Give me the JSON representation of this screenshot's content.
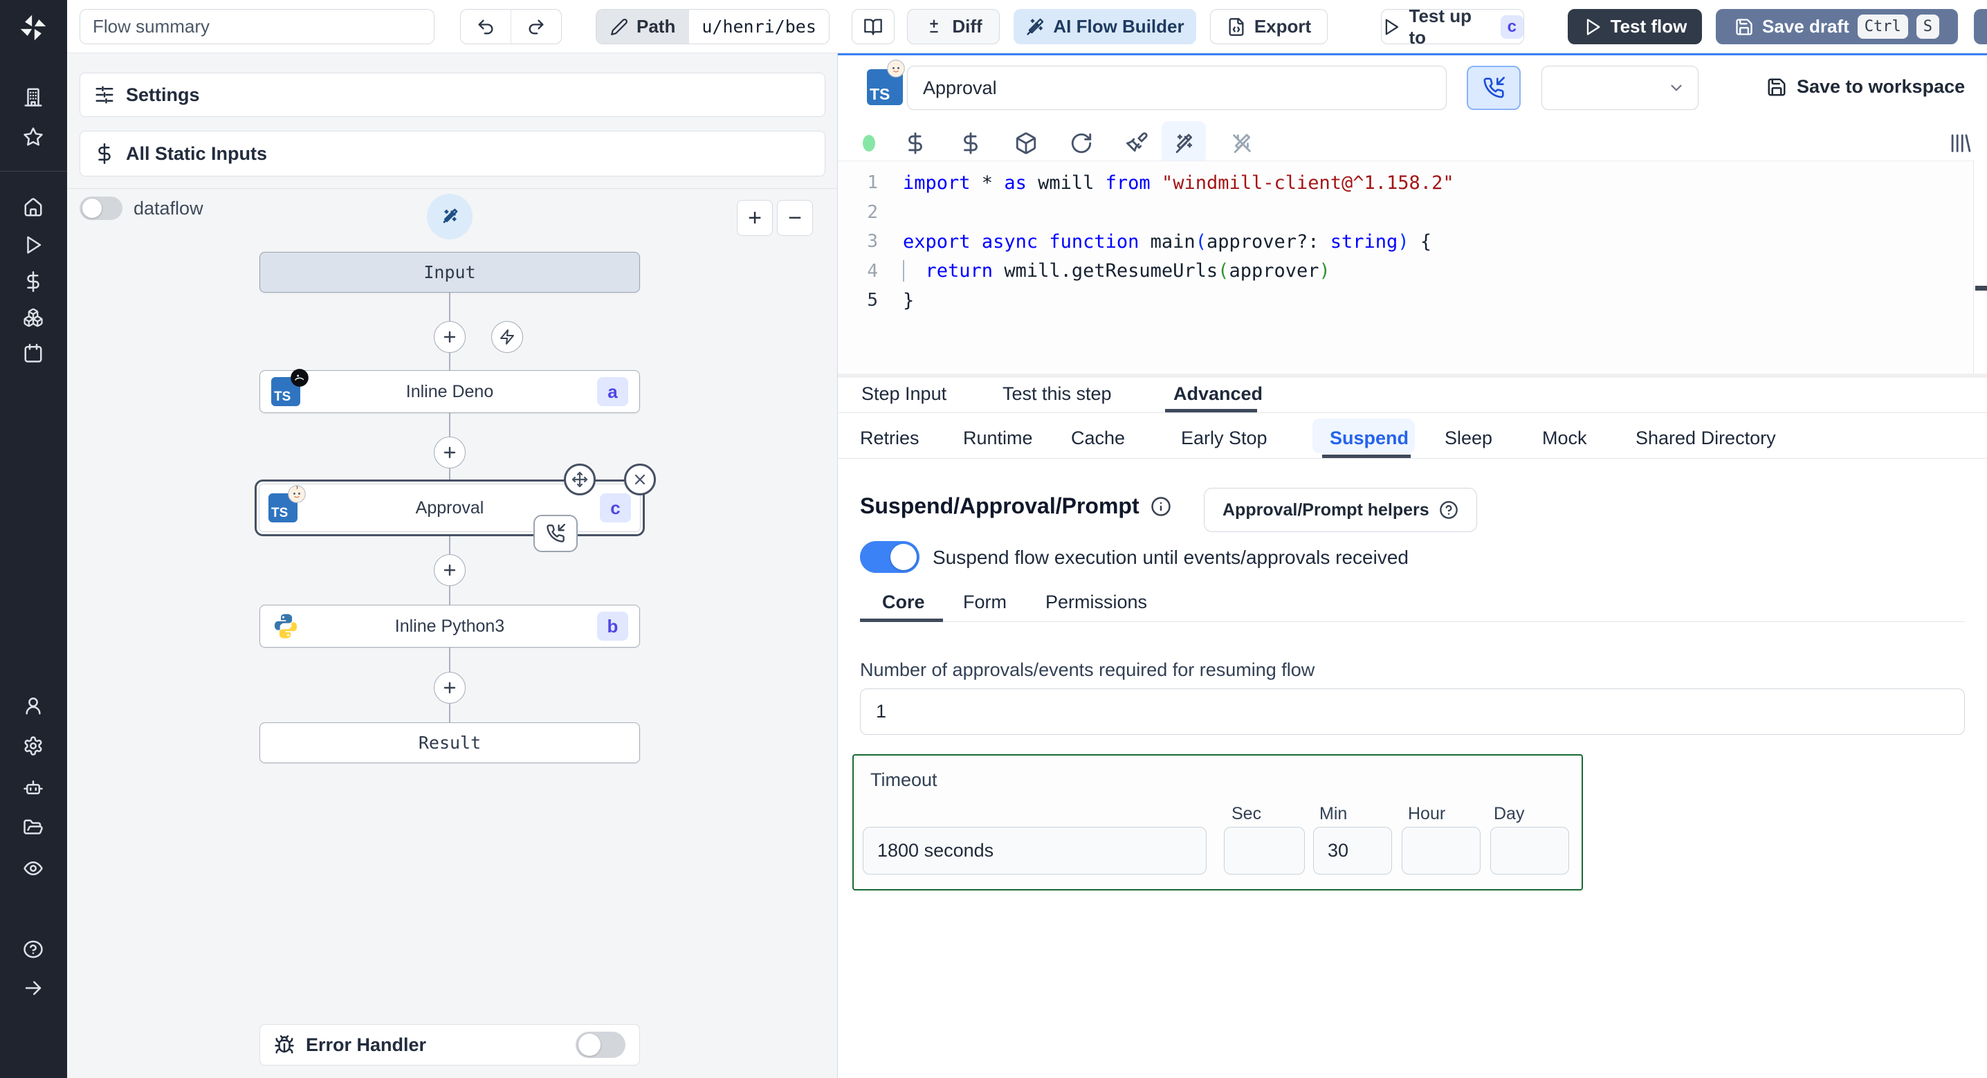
{
  "topbar": {
    "flow_summary": "Flow summary",
    "path_label": "Path",
    "path_value": "u/henri/bes",
    "diff_label": "Diff",
    "ai_builder_label": "AI Flow Builder",
    "export_label": "Export",
    "test_up_to_label": "Test up to",
    "test_up_to_badge": "c",
    "test_flow_label": "Test flow",
    "save_draft_label": "Save draft",
    "kbd_ctrl": "Ctrl",
    "kbd_s": "S"
  },
  "sidebar": {
    "icons": [
      "windmill-logo",
      "building",
      "star",
      "home",
      "play",
      "dollar",
      "boxes",
      "calendar",
      "user",
      "settings",
      "bot",
      "folder",
      "eye",
      "help",
      "expand-arrow"
    ]
  },
  "left_panel": {
    "settings_label": "Settings",
    "static_inputs_label": "All Static Inputs",
    "dataflow_label": "dataflow",
    "zoom_in": "+",
    "zoom_out": "−",
    "graph": {
      "input_label": "Input",
      "deno": {
        "label": "Inline Deno",
        "badge": "a",
        "lang": "TS"
      },
      "approval": {
        "label": "Approval",
        "badge": "c",
        "lang": "TS"
      },
      "python": {
        "label": "Inline Python3",
        "badge": "b"
      },
      "result_label": "Result",
      "error_handler_label": "Error Handler"
    }
  },
  "right_panel": {
    "step_name": "Approval",
    "lang_chip": "TS",
    "save_to_workspace": "Save to workspace",
    "editor": {
      "lines": [
        {
          "n": "1",
          "tokens": [
            {
              "c": "kw",
              "t": "import"
            },
            {
              "c": "d",
              "t": " * "
            },
            {
              "c": "kw",
              "t": "as"
            },
            {
              "c": "d",
              "t": " wmill "
            },
            {
              "c": "kw",
              "t": "from"
            },
            {
              "c": "d",
              "t": " "
            },
            {
              "c": "str",
              "t": "\"windmill-client@^1.158.2\""
            }
          ]
        },
        {
          "n": "2",
          "tokens": []
        },
        {
          "n": "3",
          "tokens": [
            {
              "c": "kw",
              "t": "export"
            },
            {
              "c": "d",
              "t": " "
            },
            {
              "c": "kw",
              "t": "async"
            },
            {
              "c": "d",
              "t": " "
            },
            {
              "c": "kw",
              "t": "function"
            },
            {
              "c": "d",
              "t": " main"
            },
            {
              "c": "pb",
              "t": "("
            },
            {
              "c": "d",
              "t": "approver?: "
            },
            {
              "c": "kw",
              "t": "string"
            },
            {
              "c": "pb",
              "t": ")"
            },
            {
              "c": "d",
              "t": " {"
            }
          ]
        },
        {
          "n": "4",
          "guide": true,
          "tokens": [
            {
              "c": "d",
              "t": "  "
            },
            {
              "c": "kw",
              "t": "return"
            },
            {
              "c": "d",
              "t": " wmill.getResumeUrls"
            },
            {
              "c": "pg",
              "t": "("
            },
            {
              "c": "d",
              "t": "approver"
            },
            {
              "c": "pg",
              "t": ")"
            }
          ]
        },
        {
          "n": "5",
          "active": true,
          "tokens": [
            {
              "c": "d",
              "t": "}"
            }
          ]
        }
      ]
    },
    "tabs": [
      "Step Input",
      "Test this step",
      "Advanced"
    ],
    "advanced_tabs": [
      "Retries",
      "Runtime",
      "Cache",
      "Early Stop",
      "Suspend",
      "Sleep",
      "Mock",
      "Shared Directory"
    ],
    "suspend": {
      "heading": "Suspend/Approval/Prompt",
      "helpers_button": "Approval/Prompt helpers",
      "toggle_label": "Suspend flow execution until events/approvals received",
      "tabs": [
        "Core",
        "Form",
        "Permissions"
      ],
      "approvals_label": "Number of approvals/events required for resuming flow",
      "approvals_value": "1",
      "timeout": {
        "label": "Timeout",
        "value": "1800 seconds",
        "sec": "Sec",
        "min": "Min",
        "hour": "Hour",
        "day": "Day",
        "min_value": "30"
      }
    }
  },
  "colors": {
    "accent_blue": "#3b82f6",
    "badge_bg": "#e0e7ff",
    "badge_text": "#4f46e5",
    "save_draft_bg": "#64779b",
    "test_flow_bg": "#313a48",
    "timeout_border": "#176b34",
    "suspend_tab_text": "#2563eb",
    "sidebar_bg": "#20242e"
  }
}
